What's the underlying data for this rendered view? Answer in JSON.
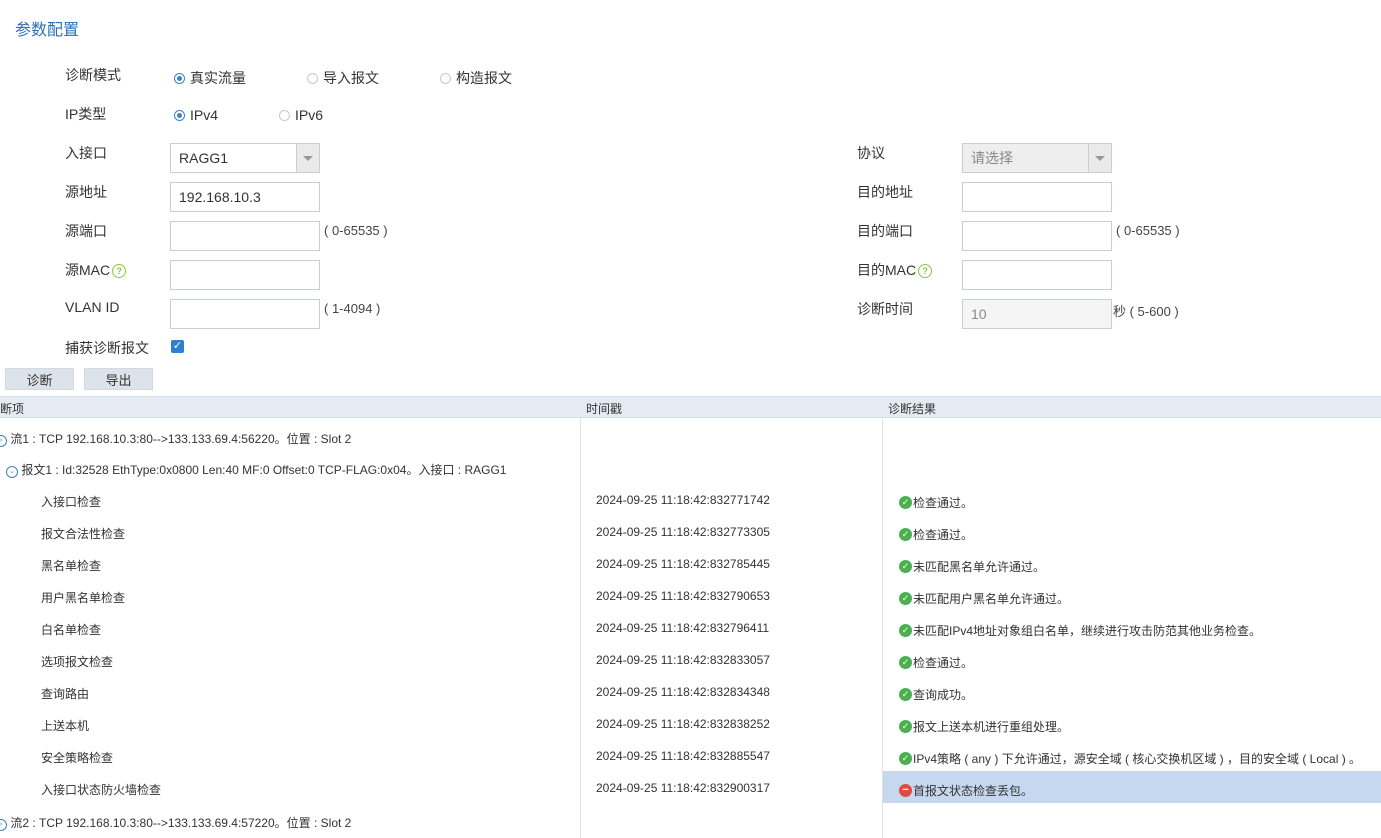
{
  "section_title": "参数配置",
  "form": {
    "diag_mode": {
      "label": "诊断模式",
      "options": [
        "真实流量",
        "导入报文",
        "构造报文"
      ],
      "selected": "真实流量"
    },
    "ip_type": {
      "label": "IP类型",
      "options": [
        "IPv4",
        "IPv6"
      ],
      "selected": "IPv4"
    },
    "in_interface": {
      "label": "入接口",
      "value": "RAGG1"
    },
    "protocol": {
      "label": "协议",
      "placeholder": "请选择"
    },
    "src_addr": {
      "label": "源地址",
      "value": "192.168.10.3"
    },
    "dst_addr": {
      "label": "目的地址",
      "value": ""
    },
    "src_port": {
      "label": "源端口",
      "value": "",
      "hint": "( 0-65535 )"
    },
    "dst_port": {
      "label": "目的端口",
      "value": "",
      "hint": "( 0-65535 )"
    },
    "src_mac": {
      "label": "源MAC",
      "value": ""
    },
    "dst_mac": {
      "label": "目的MAC",
      "value": ""
    },
    "vlan_id": {
      "label": "VLAN ID",
      "value": "",
      "hint": "( 1-4094 )"
    },
    "diag_time": {
      "label": "诊断时间",
      "value": "10",
      "hint": "秒 ( 5-600 )"
    },
    "capture": {
      "label": "捕获诊断报文",
      "checked": true
    }
  },
  "buttons": {
    "diagnose": "诊断",
    "export": "导出"
  },
  "table": {
    "headers": [
      "断项",
      "时间戳",
      "诊断结果"
    ],
    "flow1": "流1 : TCP 192.168.10.3:80-->133.133.69.4:56220。位置 : Slot 2",
    "packet1": "报文1 : Id:32528 EthType:0x0800 Len:40 MF:0 Offset:0 TCP-FLAG:0x04。入接口 : RAGG1",
    "rows": [
      {
        "item": "入接口检查",
        "time": "2024-09-25 11:18:42:832771742",
        "result": "检查通过。",
        "status": "ok"
      },
      {
        "item": "报文合法性检查",
        "time": "2024-09-25 11:18:42:832773305",
        "result": "检查通过。",
        "status": "ok"
      },
      {
        "item": "黑名单检查",
        "time": "2024-09-25 11:18:42:832785445",
        "result": "未匹配黑名单允许通过。",
        "status": "ok"
      },
      {
        "item": "用户黑名单检查",
        "time": "2024-09-25 11:18:42:832790653",
        "result": "未匹配用户黑名单允许通过。",
        "status": "ok"
      },
      {
        "item": "白名单检查",
        "time": "2024-09-25 11:18:42:832796411",
        "result": "未匹配IPv4地址对象组白名单，继续进行攻击防范其他业务检查。",
        "status": "ok"
      },
      {
        "item": "选项报文检查",
        "time": "2024-09-25 11:18:42:832833057",
        "result": "检查通过。",
        "status": "ok"
      },
      {
        "item": "查询路由",
        "time": "2024-09-25 11:18:42:832834348",
        "result": "查询成功。",
        "status": "ok"
      },
      {
        "item": "上送本机",
        "time": "2024-09-25 11:18:42:832838252",
        "result": "报文上送本机进行重组处理。",
        "status": "ok"
      },
      {
        "item": "安全策略检查",
        "time": "2024-09-25 11:18:42:832885547",
        "result": "IPv4策略 ( any ) 下允许通过，源安全域 ( 核心交换机区域 ) ，目的安全域 ( Local ) 。",
        "status": "ok"
      },
      {
        "item": "入接口状态防火墙检查",
        "time": "2024-09-25 11:18:42:832900317",
        "result": "首报文状态检查丢包。",
        "status": "error"
      }
    ],
    "flow2": "流2 : TCP 192.168.10.3:80-->133.133.69.4:57220。位置 : Slot 2"
  }
}
